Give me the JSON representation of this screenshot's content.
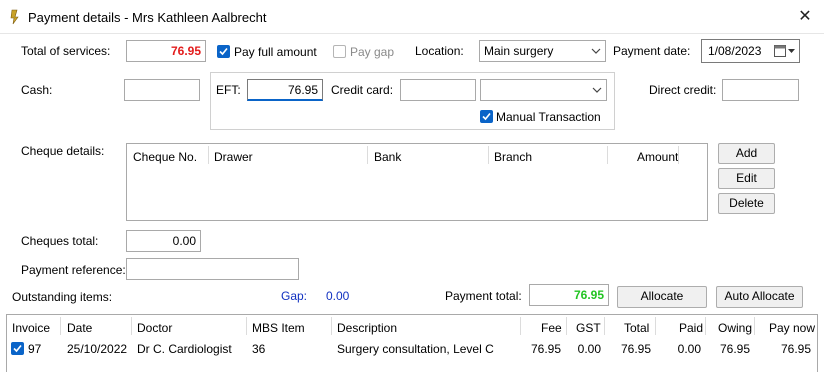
{
  "window": {
    "title": "Payment details - Mrs Kathleen Aalbrecht",
    "close_icon": "close-icon"
  },
  "form": {
    "total_services_label": "Total of services:",
    "total_services_value": "76.95",
    "pay_full_label": "Pay full amount",
    "pay_full_checked": true,
    "pay_gap_label": "Pay gap",
    "pay_gap_checked": false,
    "location_label": "Location:",
    "location_value": "Main surgery",
    "payment_date_label": "Payment date:",
    "payment_date_value": "1/08/2023",
    "cash_label": "Cash:",
    "cash_value": "",
    "eft_label": "EFT:",
    "eft_value": "76.95",
    "credit_card_label": "Credit card:",
    "credit_card_value": "",
    "credit_card_type": "",
    "manual_transaction_label": "Manual Transaction",
    "manual_transaction_checked": true,
    "direct_credit_label": "Direct credit:",
    "direct_credit_value": "",
    "cheque_details_label": "Cheque details:",
    "cheques_total_label": "Cheques total:",
    "cheques_total_value": "0.00",
    "payment_reference_label": "Payment reference:",
    "payment_reference_value": "",
    "outstanding_items_label": "Outstanding items:",
    "gap_label": "Gap:",
    "gap_value": "0.00",
    "payment_total_label": "Payment total:",
    "payment_total_value": "76.95"
  },
  "cheque_table": {
    "headers": [
      "Cheque No.",
      "Drawer",
      "Bank",
      "Branch",
      "Amount"
    ]
  },
  "cheque_buttons": {
    "add": "Add",
    "edit": "Edit",
    "delete": "Delete"
  },
  "actions": {
    "allocate": "Allocate",
    "auto_allocate": "Auto Allocate"
  },
  "items_table": {
    "headers": [
      "Invoice",
      "Date",
      "Doctor",
      "MBS Item",
      "Description",
      "Fee",
      "GST",
      "Total",
      "Paid",
      "Owing",
      "Pay now"
    ],
    "rows": [
      {
        "checked": true,
        "invoice": "97",
        "date": "25/10/2022",
        "doctor": "Dr C. Cardiologist",
        "mbs_item": "36",
        "description": "Surgery consultation, Level C",
        "fee": "76.95",
        "gst": "0.00",
        "total": "76.95",
        "paid": "0.00",
        "owing": "76.95",
        "pay_now": "76.95"
      }
    ]
  },
  "colors": {
    "total_services": "#e31b1b",
    "payment_total": "#22c422",
    "gap": "#1030c0",
    "checkbox": "#0a64c8"
  }
}
